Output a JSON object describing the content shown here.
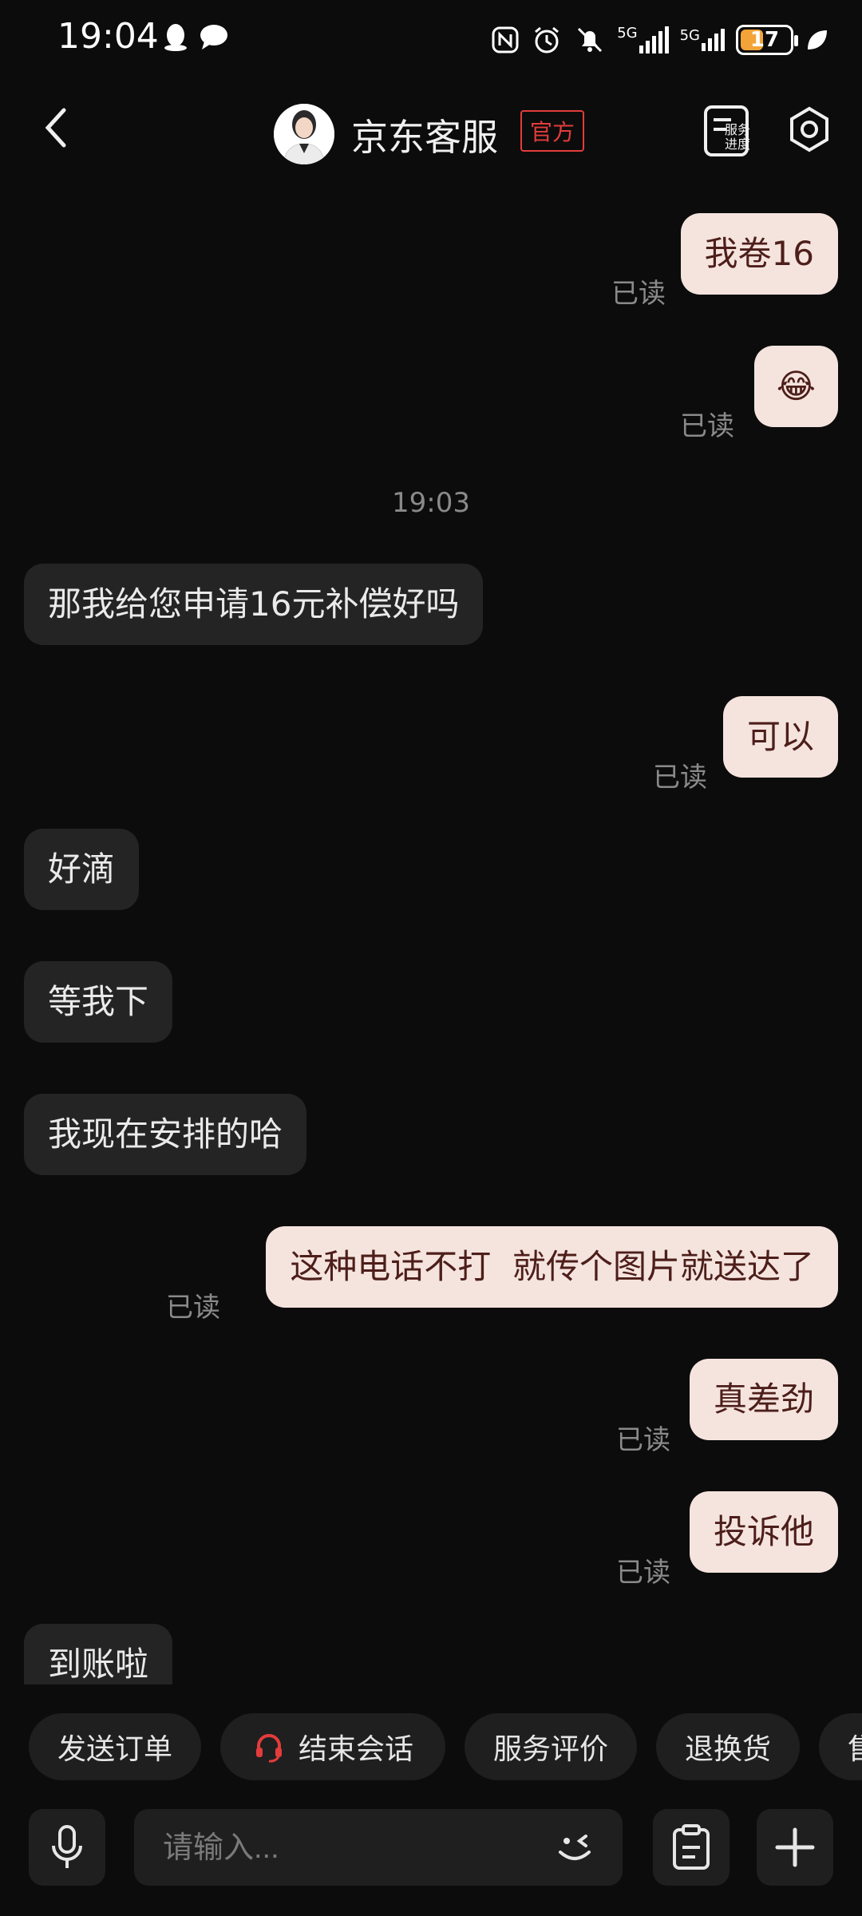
{
  "status_bar": {
    "time": "19:04",
    "network": "5G",
    "battery": "17"
  },
  "header": {
    "title": "京东客服",
    "badge": "官方",
    "service_progress_label": "服务\n进度"
  },
  "chat": {
    "read_label": "已读",
    "timestamp": "19:03",
    "messages": [
      {
        "side": "out",
        "text": "我卷16"
      },
      {
        "side": "out",
        "text": "😂"
      },
      {
        "side": "in",
        "text": "那我给您申请16元补偿好吗"
      },
      {
        "side": "out",
        "text": "可以"
      },
      {
        "side": "in",
        "text": "好滴"
      },
      {
        "side": "in",
        "text": "等我下"
      },
      {
        "side": "in",
        "text": "我现在安排的哈"
      },
      {
        "side": "out",
        "text": "这种电话不打  就传个图片就送达了"
      },
      {
        "side": "out",
        "text": "真差劲"
      },
      {
        "side": "out",
        "text": "投诉他"
      },
      {
        "side": "in",
        "text": "到账啦"
      }
    ]
  },
  "quick_actions": [
    {
      "label": "发送订单"
    },
    {
      "label": "结束会话"
    },
    {
      "label": "服务评价"
    },
    {
      "label": "退换货"
    },
    {
      "label": "售"
    }
  ],
  "input": {
    "placeholder": "请输入..."
  },
  "colors": {
    "accent_red": "#e33c3c",
    "outgoing_bubble": "#f5e4de",
    "incoming_bubble": "#242424"
  }
}
